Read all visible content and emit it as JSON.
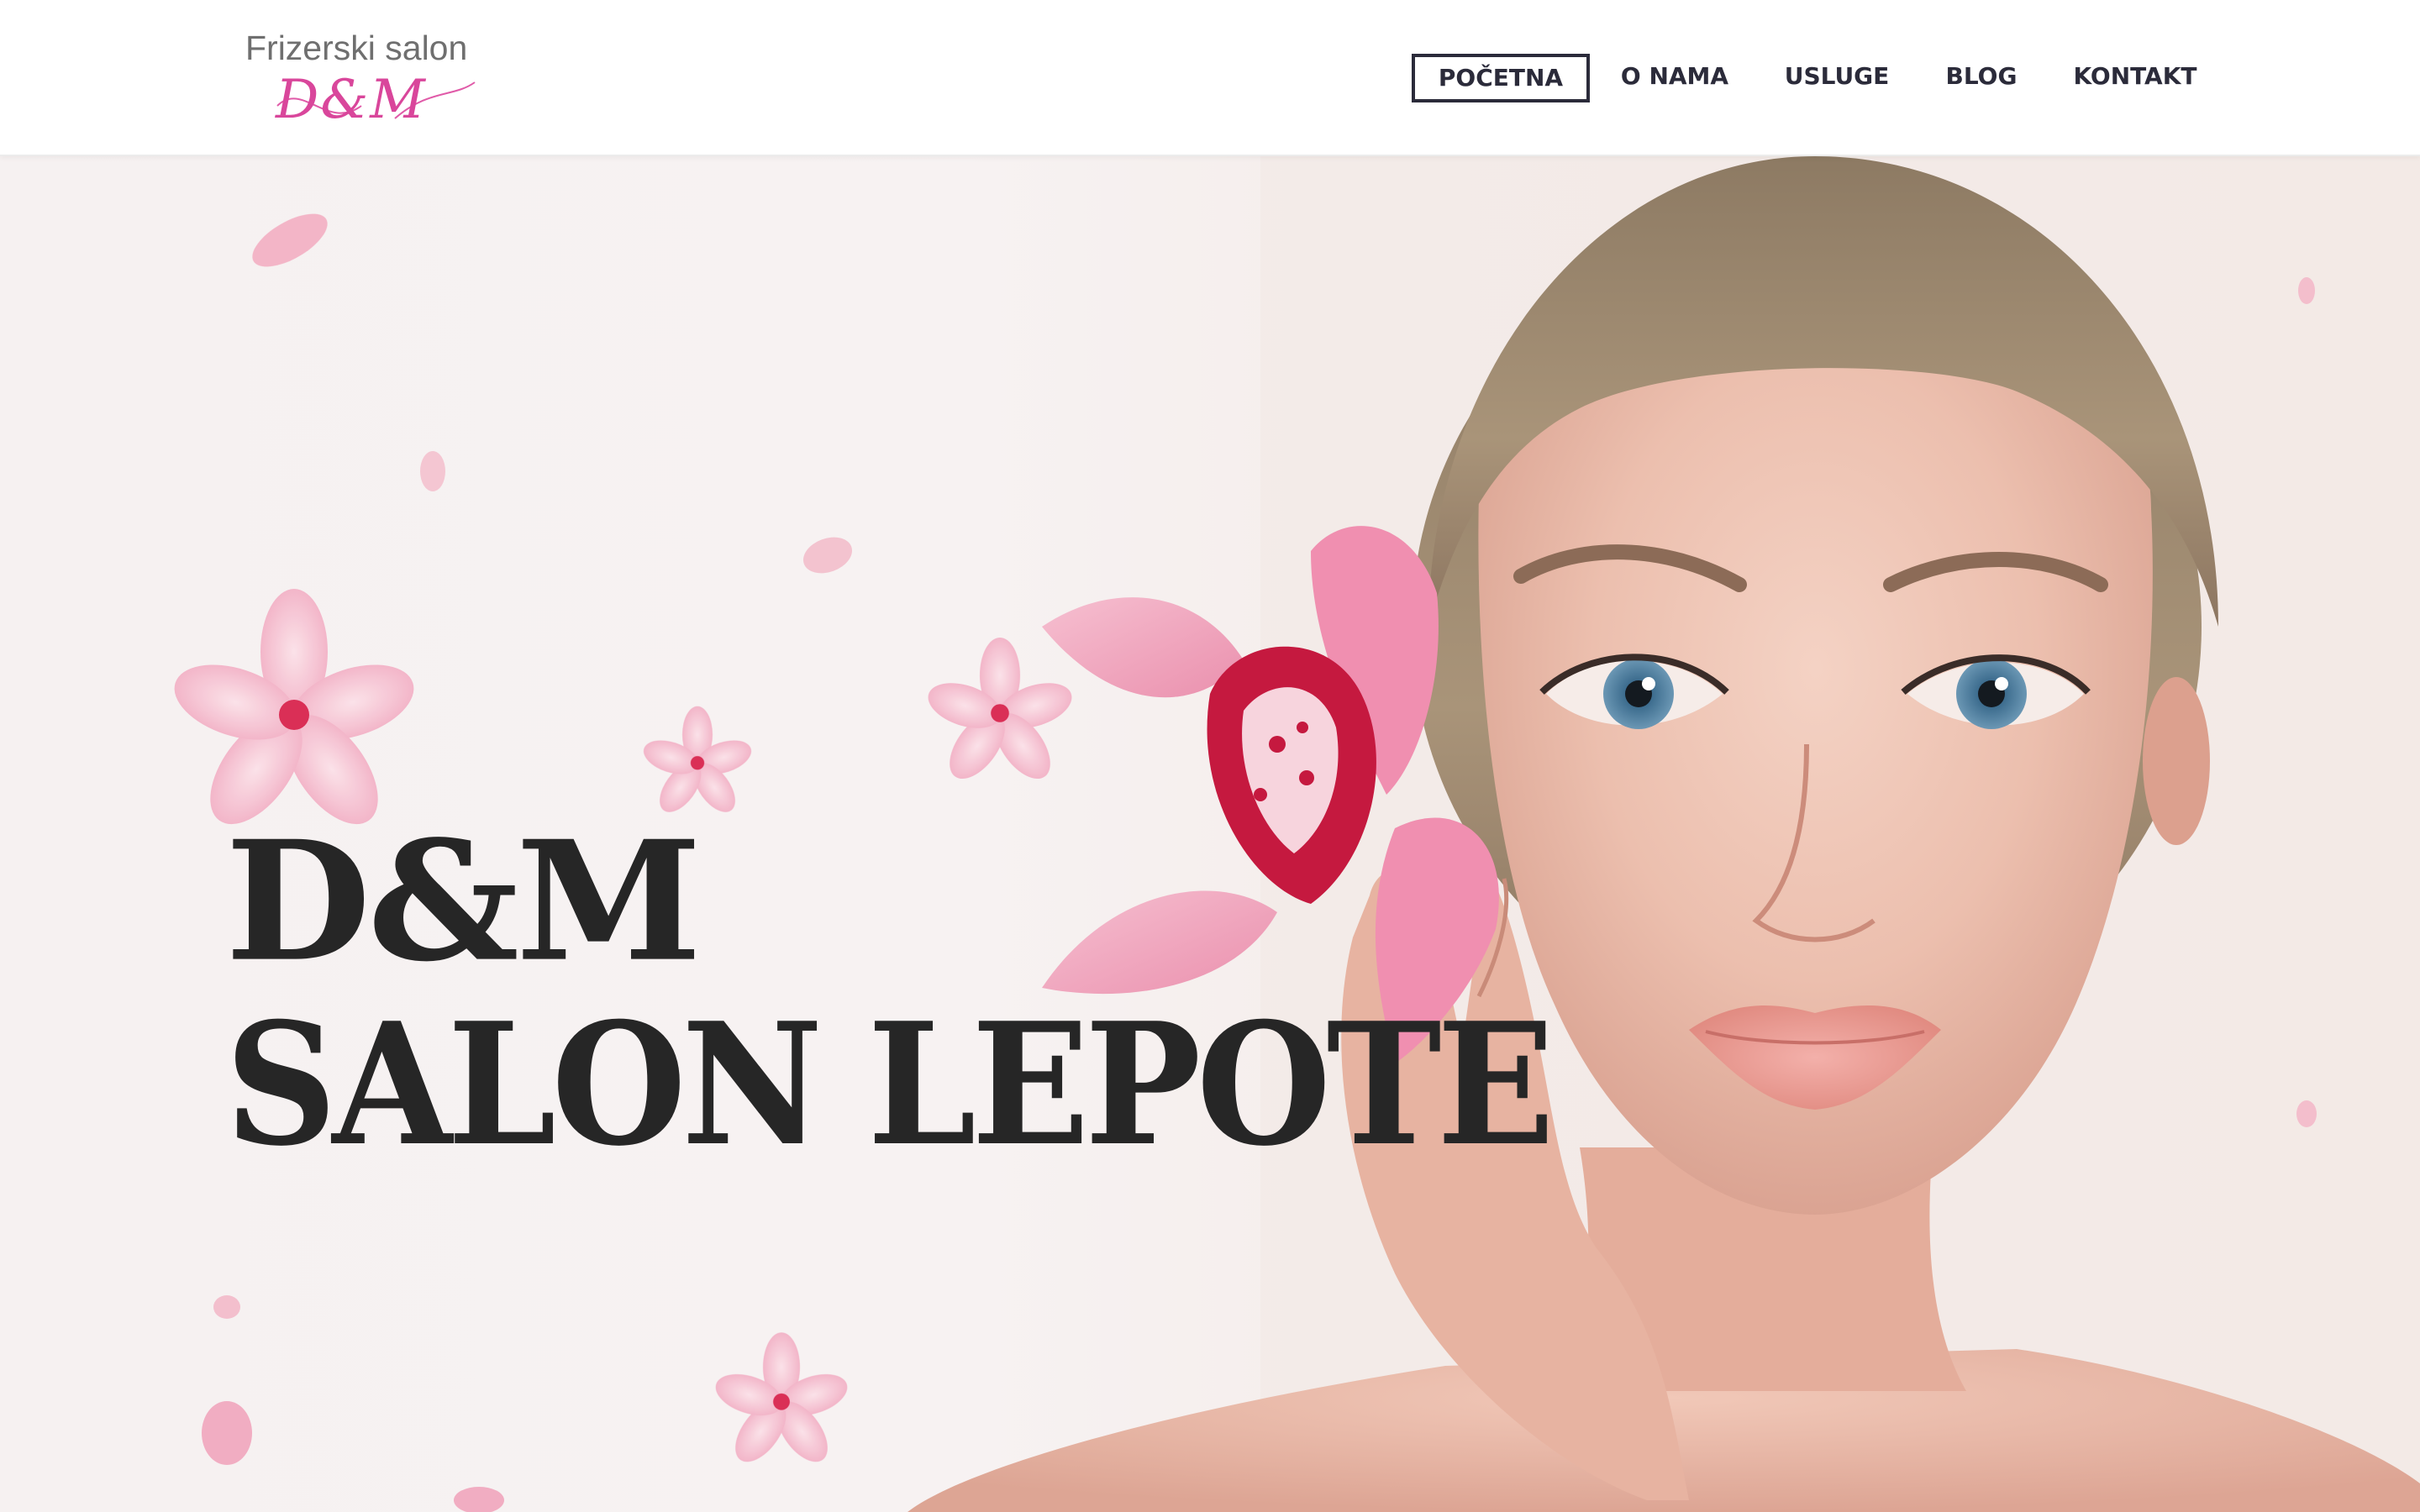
{
  "brand": {
    "top_text": "Frizerski salon",
    "script_text": "D&M"
  },
  "nav": {
    "items": [
      {
        "label": "POČETNA",
        "active": true
      },
      {
        "label": "O NAMA",
        "active": false
      },
      {
        "label": "USLUGE",
        "active": false
      },
      {
        "label": "BLOG",
        "active": false
      },
      {
        "label": "KONTAKT",
        "active": false
      }
    ]
  },
  "hero": {
    "title_line1": "D&M",
    "title_line2": "SALON LEPOTE",
    "image_icon": "woman-with-orchid-photo"
  },
  "colors": {
    "nav_text": "#2b2b3a",
    "brand_pink": "#d9469b",
    "title": "#262626",
    "petal_pink": "#f0a9bf"
  }
}
